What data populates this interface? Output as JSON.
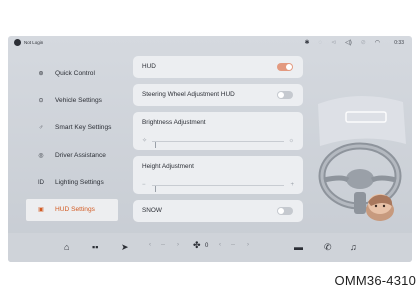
{
  "status_bar": {
    "user_label": "Not Login",
    "time": "0:33",
    "icons": [
      "bluetooth-icon",
      "signal-icon",
      "mute-icon",
      "volume-icon",
      "wifi-off-icon",
      "wifi-icon"
    ]
  },
  "sidebar": {
    "items": [
      {
        "label": "Quick Control",
        "icon": "quick-control-icon",
        "glyph": "⊛",
        "active": false
      },
      {
        "label": "Vehicle Settings",
        "icon": "vehicle-settings-icon",
        "glyph": "⊙",
        "active": false
      },
      {
        "label": "Smart Key Settings",
        "icon": "key-icon",
        "glyph": "♂",
        "active": false
      },
      {
        "label": "Driver Assistance",
        "icon": "driver-assist-icon",
        "glyph": "◎",
        "active": false
      },
      {
        "label": "Lighting Settings",
        "icon": "lighting-icon",
        "glyph": "ID",
        "active": false
      },
      {
        "label": "HUD Settings",
        "icon": "hud-icon",
        "glyph": "▣",
        "active": true
      }
    ]
  },
  "settings": {
    "hud": {
      "label": "HUD",
      "enabled": true
    },
    "steering_wheel_hud": {
      "label": "Steering Wheel Adjustment HUD",
      "enabled": false
    },
    "brightness": {
      "label": "Brightness Adjustment",
      "value_fraction": 0.02
    },
    "height": {
      "label": "Height Adjustment",
      "value_fraction": 0.02
    },
    "snow": {
      "label": "SNOW",
      "enabled": false
    }
  },
  "dock": {
    "left_icons": [
      "home-icon",
      "apps-icon",
      "navigation-icon"
    ],
    "climate": {
      "left_temp": "--",
      "right_temp": "--",
      "fan_value": "0"
    },
    "right_icons": [
      "car-icon",
      "phone-icon",
      "music-icon"
    ]
  },
  "colors": {
    "accent": "#d35b23",
    "toggle_on": "#e39a80",
    "toggle_off": "#c5c9cf"
  },
  "caption": "OMM36-4310"
}
